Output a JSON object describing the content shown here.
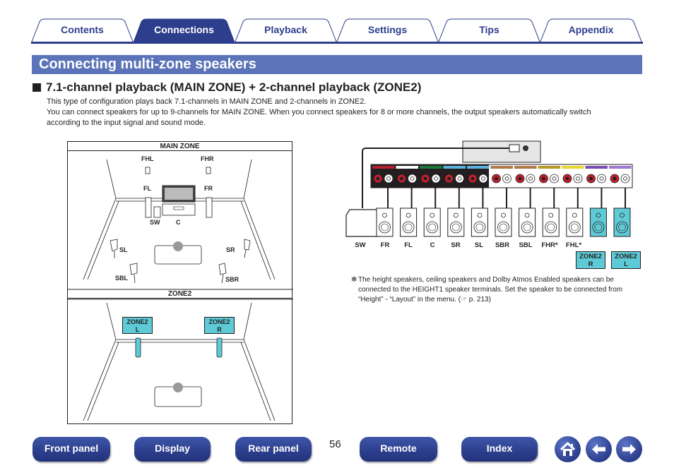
{
  "tabs": [
    {
      "label": "Contents",
      "active": false
    },
    {
      "label": "Connections",
      "active": true
    },
    {
      "label": "Playback",
      "active": false
    },
    {
      "label": "Settings",
      "active": false
    },
    {
      "label": "Tips",
      "active": false
    },
    {
      "label": "Appendix",
      "active": false
    }
  ],
  "page": {
    "title": "Connecting multi-zone speakers",
    "subheading": "7.1-channel playback (MAIN ZONE) + 2-channel playback (ZONE2)",
    "description": [
      "This type of configuration plays back 7.1-channels in MAIN ZONE and 2-channels in ZONE2.",
      "You can connect speakers for up to 9-channels for MAIN ZONE. When you connect speakers for 8 or more channels, the output speakers automatically switch according to the input signal and sound mode."
    ]
  },
  "main_zone": {
    "label": "MAIN ZONE",
    "speakers": {
      "fhl": "FHL",
      "fhr": "FHR",
      "fl": "FL",
      "fr": "FR",
      "sw": "SW",
      "c": "C",
      "sl": "SL",
      "sr": "SR",
      "sbl": "SBL",
      "sbr": "SBR"
    }
  },
  "zone2": {
    "label": "ZONE2",
    "left": {
      "line1": "ZONE2",
      "line2": "L"
    },
    "right": {
      "line1": "ZONE2",
      "line2": "R"
    }
  },
  "connection": {
    "speaker_labels": [
      "SW",
      "FR",
      "FL",
      "C",
      "SR",
      "SL",
      "SBR",
      "SBL",
      "FHR*",
      "FHL*"
    ],
    "zone2_outputs": [
      {
        "line1": "ZONE2",
        "line2": "R"
      },
      {
        "line1": "ZONE2",
        "line2": "L"
      }
    ],
    "terminal_colors": [
      "#b5202f",
      "#ffffff",
      "#1b7a3e",
      "#5ab4e0",
      "#5ab4e0",
      "#b07a4a",
      "#b07a4a",
      "#b89a2c",
      "#e8d832",
      "#7b4fb0",
      "#9b7ad0"
    ],
    "zone2_color": "#5ecad6"
  },
  "note": {
    "marker": "✻",
    "text": "The height speakers, ceiling speakers and Dolby Atmos Enabled speakers can be connected to the HEIGHT1 speaker terminals. Set the speaker to be connected from “Height” - “Layout” in the menu.",
    "ref": "(☞ p. 213)"
  },
  "footer": {
    "buttons": [
      "Front panel",
      "Display",
      "Rear panel",
      "Remote",
      "Index"
    ],
    "page_number": "56",
    "icons": [
      "home-icon",
      "back-arrow-icon",
      "forward-arrow-icon"
    ]
  },
  "colors": {
    "brand": "#2c3e8c",
    "title_bar": "#5b73b8",
    "zone2": "#5ecad6"
  }
}
